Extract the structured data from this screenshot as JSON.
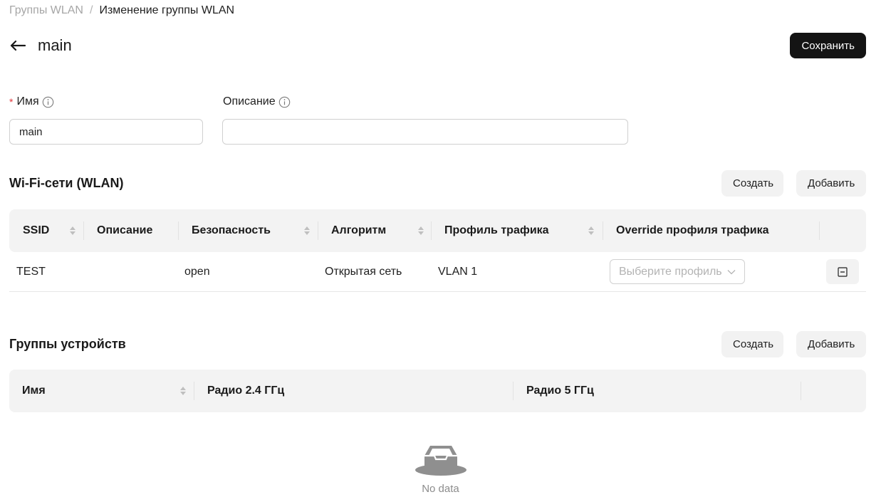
{
  "breadcrumb": {
    "parent": "Группы WLAN",
    "separator": "/",
    "current": "Изменение группы WLAN"
  },
  "header": {
    "title": "main",
    "save_label": "Сохранить"
  },
  "form": {
    "name_label": "Имя",
    "name_value": "main",
    "description_label": "Описание",
    "description_value": ""
  },
  "wlan_section": {
    "title": "Wi-Fi-сети (WLAN)",
    "create_label": "Создать",
    "add_label": "Добавить",
    "columns": [
      "SSID",
      "Описание",
      "Безопасность",
      "Алгоритм",
      "Профиль трафика",
      "Override профиля трафика"
    ],
    "rows": [
      {
        "ssid": "TEST",
        "description": "",
        "security": "open",
        "algorithm": "Открытая сеть",
        "traffic_profile": "VLAN 1",
        "override_placeholder": "Выберите профиль"
      }
    ]
  },
  "device_groups": {
    "title": "Группы устройств",
    "create_label": "Создать",
    "add_label": "Добавить",
    "columns": [
      "Имя",
      "Радио 2.4 ГГц",
      "Радио 5 ГГц"
    ],
    "empty_text": "No data"
  },
  "colors": {
    "primary_button": "#141414",
    "required": "#e0363a",
    "table_header": "#f3f3f3"
  }
}
